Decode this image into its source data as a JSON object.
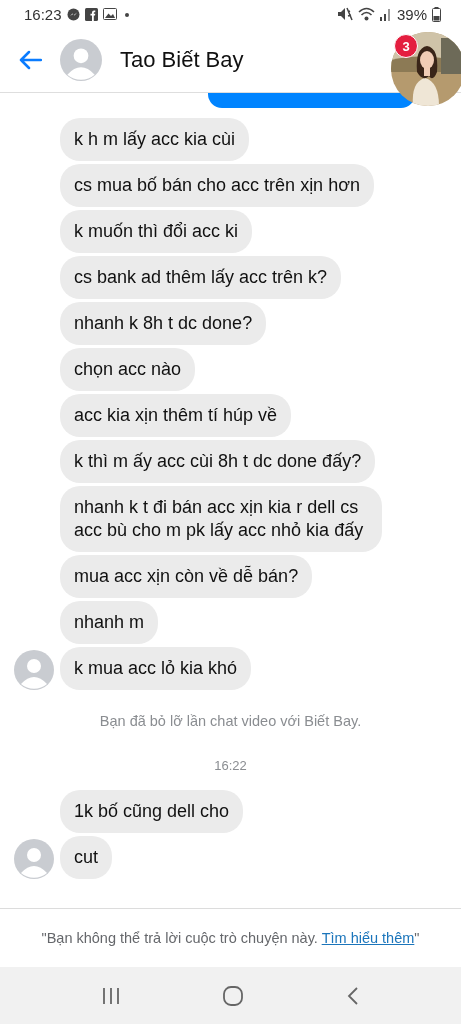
{
  "status_bar": {
    "time": "16:23",
    "battery": "39%"
  },
  "header": {
    "title": "Tao Biết Bay"
  },
  "chat_head": {
    "badge": "3"
  },
  "messages": [
    {
      "kind": "sent_partial"
    },
    {
      "kind": "received",
      "text": "k h m lấy acc kia cùi"
    },
    {
      "kind": "received",
      "text": "cs mua bố bán cho acc trên xịn hơn"
    },
    {
      "kind": "received",
      "text": "k muốn thì đổi acc ki"
    },
    {
      "kind": "received",
      "text": "cs bank ad thêm lấy acc trên k?"
    },
    {
      "kind": "received",
      "text": "nhanh k 8h t dc done?"
    },
    {
      "kind": "received",
      "text": "chọn acc nào"
    },
    {
      "kind": "received",
      "text": "acc kia xịn thêm tí húp về"
    },
    {
      "kind": "received",
      "text": "k thì m ấy acc cùi 8h t dc done đấy?"
    },
    {
      "kind": "received",
      "text": "nhanh k t đi bán acc xịn kia r dell cs acc bù cho m pk lấy acc nhỏ kia đấy"
    },
    {
      "kind": "received",
      "text": "mua acc xịn còn về dễ bán?"
    },
    {
      "kind": "received",
      "text": "nhanh m"
    },
    {
      "kind": "received_with_avatar",
      "text": "k mua acc lỏ kia khó"
    },
    {
      "kind": "notice",
      "text": "Bạn đã bỏ lỡ lần chat video với Biết Bay."
    },
    {
      "kind": "time",
      "text": "16:22"
    },
    {
      "kind": "received",
      "text": "1k bố cũng dell cho"
    },
    {
      "kind": "received_with_avatar",
      "text": "cut"
    }
  ],
  "footer": {
    "text": "\"Bạn không thể trả lời cuộc trò chuyện này.",
    "link": "Tìm hiểu thêm",
    "closing": "\""
  }
}
